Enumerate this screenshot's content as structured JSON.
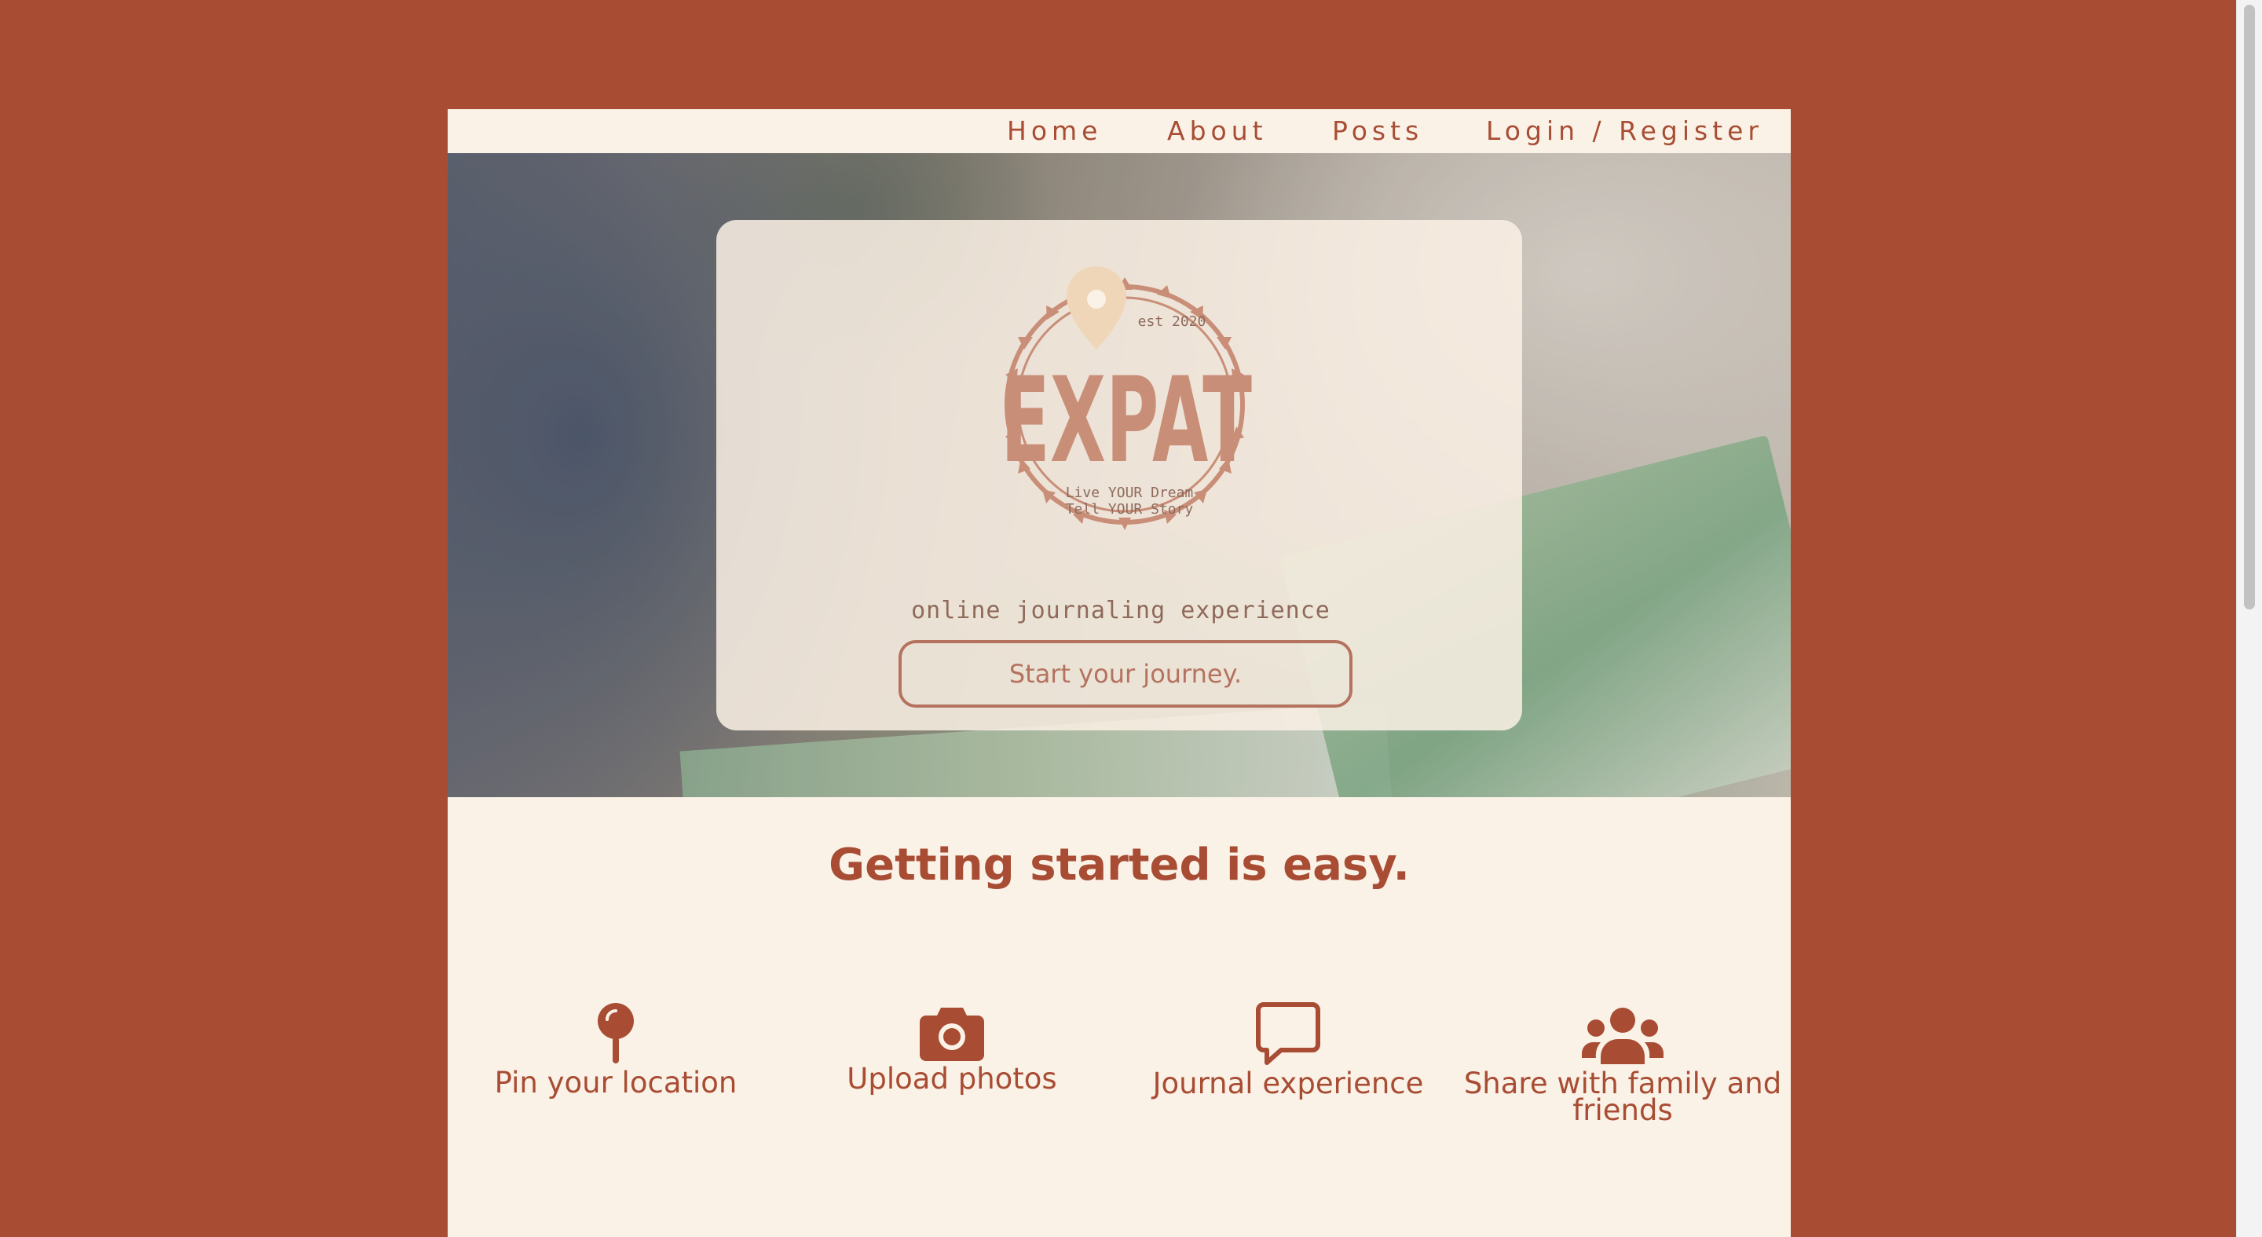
{
  "nav": {
    "items": [
      {
        "label": "Home"
      },
      {
        "label": "About"
      },
      {
        "label": "Posts"
      },
      {
        "label": "Login / Register"
      }
    ]
  },
  "hero": {
    "logo": {
      "brand": "EXPAT",
      "established": "est 2020",
      "motto_line1": "Live YOUR Dream",
      "motto_line2": "Tell YOUR Story"
    },
    "tagline": "online journaling experience",
    "cta_label": "Start your journey."
  },
  "getting_started": {
    "title": "Getting started is easy.",
    "features": [
      {
        "label": "Pin your location",
        "icon": "map-pin-icon"
      },
      {
        "label": "Upload photos",
        "icon": "camera-icon"
      },
      {
        "label": "Journal experience",
        "icon": "comment-icon"
      },
      {
        "label": "Share with family and friends",
        "icon": "users-icon"
      }
    ]
  },
  "colors": {
    "background": "#a84d34",
    "page": "#fbf2e7",
    "accent": "#a84d34"
  }
}
